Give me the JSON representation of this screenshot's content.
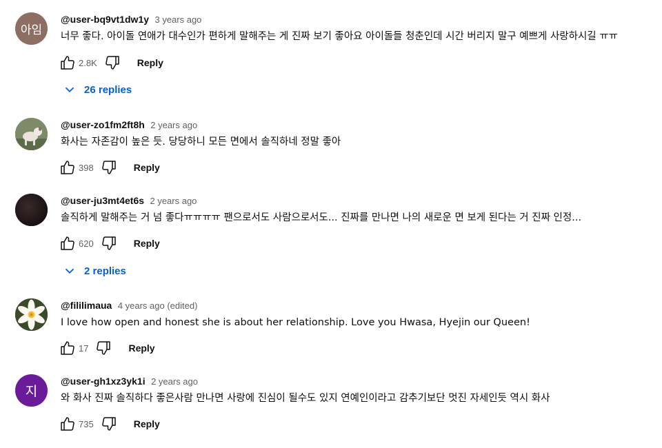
{
  "comments": [
    {
      "author": "@user-bq9vt1dw1y",
      "time": "3 years ago",
      "text": "너무 좋다. 아이돌 연애가 대수인가 편하게 말해주는 게 진짜 보기 좋아요 아이돌들 청춘인데 시간 버리지 말구 예쁘게 사랑하시길 ㅠㅠ",
      "likes": "2.8K",
      "reply_label": "Reply",
      "avatar_text": "아임",
      "avatar_color": "#8d6e63",
      "replies_label": "26 replies"
    },
    {
      "author": "@user-zo1fm2ft8h",
      "time": "2 years ago",
      "text": "화사는 자존감이 높은 듯. 당당하니 모든 면에서 솔직하네 정말 좋아",
      "likes": "398",
      "reply_label": "Reply",
      "avatar_icon": "dog-photo-icon"
    },
    {
      "author": "@user-ju3mt4et6s",
      "time": "2 years ago",
      "text": "솔직하게 말해주는 거 넘 좋다ㅠㅠㅠㅠ 팬으로서도 사람으로서도... 진짜를 만나면 나의 새로운 면 보게 된다는 거 진짜 인정...",
      "likes": "620",
      "reply_label": "Reply",
      "avatar_icon": "dark-photo-icon",
      "replies_label": "2 replies"
    },
    {
      "author": "@fililimaua",
      "time": "4 years ago (edited)",
      "text": "I love how open and honest she is about her relationship. Love you Hwasa, Hyejin our Queen!",
      "likes": "17",
      "reply_label": "Reply",
      "avatar_icon": "lily-flower-icon"
    },
    {
      "author": "@user-gh1xz3yk1i",
      "time": "2 years ago",
      "text": "와 화사 진짜 솔직하다 좋은사람 만나면 사랑에 진심이 될수도 있지 연예인이라고 감추기보단 멋진 자세인듯 역시 화사",
      "likes": "735",
      "reply_label": "Reply",
      "avatar_text": "지",
      "avatar_color": "#6a1b9a"
    }
  ],
  "colors": {
    "link_blue": "#065fd4",
    "secondary_text": "#606060"
  }
}
